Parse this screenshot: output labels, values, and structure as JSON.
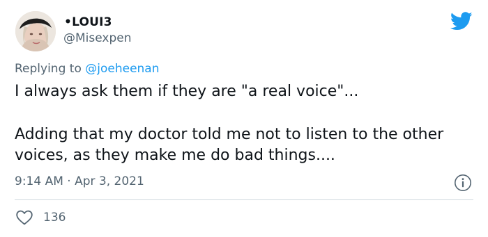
{
  "author": {
    "display_name": "•LOUI3",
    "handle": "@Misexpen"
  },
  "reply": {
    "prefix": "Replying to",
    "mention": "@joeheenan"
  },
  "tweet": {
    "line1": "I always ask them if they are \"a real voice\"...",
    "line2": "Adding that my doctor told me not to listen to the other voices, as they make me do bad things...."
  },
  "meta": {
    "timestamp": "9:14 AM · Apr 3, 2021"
  },
  "engagement": {
    "likes": "136"
  },
  "icons": {
    "brand": "twitter-bird-icon",
    "info": "info-icon",
    "like": "heart-icon"
  },
  "colors": {
    "twitter_blue": "#1d9bf0",
    "secondary_text": "#536471",
    "primary_text": "#0f1419",
    "divider": "#cfd9de"
  }
}
